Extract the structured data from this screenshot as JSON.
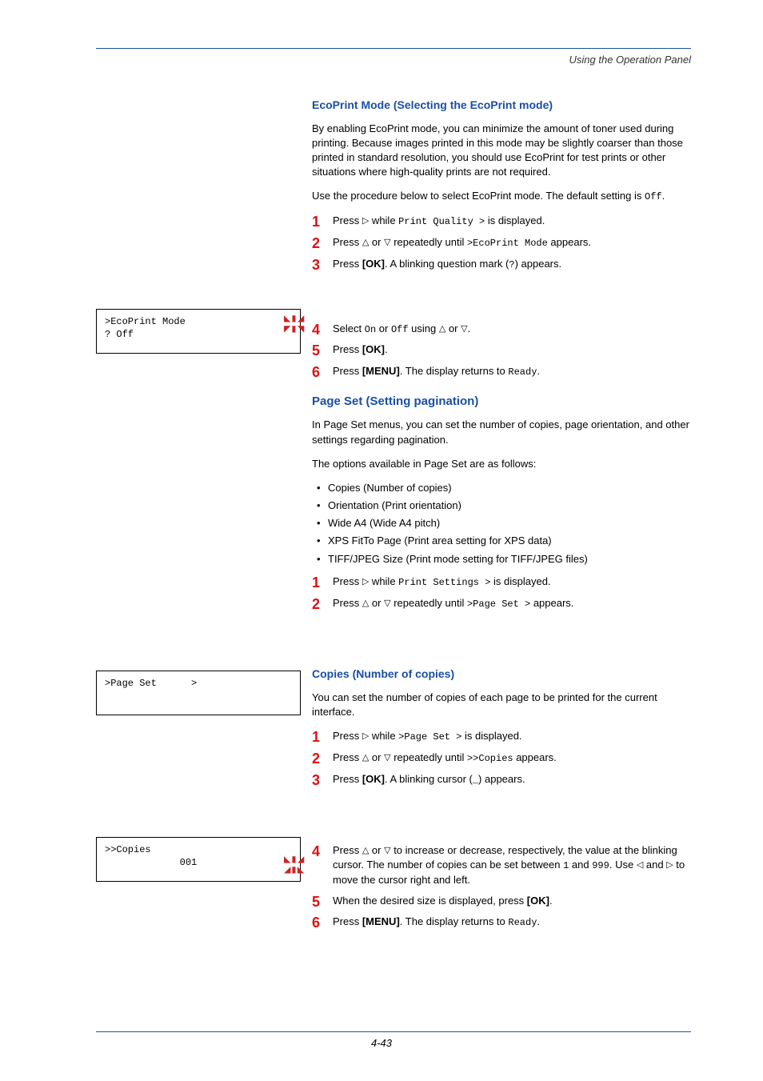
{
  "header": {
    "section": "Using the Operation Panel"
  },
  "ecoprint": {
    "title": "EcoPrint Mode (Selecting the EcoPrint mode)",
    "p1": "By enabling EcoPrint mode, you can minimize the amount of toner used during printing. Because images printed in this mode may be slightly coarser than those printed in standard resolution, you should use EcoPrint for test prints or other situations where high-quality prints are not required.",
    "p2": "Use the procedure below to select EcoPrint mode. The default setting is Off.",
    "steps": {
      "s1a": "Press ",
      "s1b": " while ",
      "s1c": "Print Quality >",
      "s1d": " is displayed.",
      "s2a": "Press ",
      "s2b": " or ",
      "s2c": " repeatedly until ",
      "s2d": ">EcoPrint Mode",
      "s2e": " appears.",
      "s3a": "Press ",
      "s3b": "[OK]",
      "s3c": ". A blinking question mark (",
      "s3d": "?",
      "s3e": ") appears.",
      "s4a": "Select ",
      "s4b": "On",
      "s4c": " or ",
      "s4d": "Off",
      "s4e": " using ",
      "s4f": " or ",
      "s4g": ".",
      "s5a": "Press ",
      "s5b": "[OK]",
      "s5c": ".",
      "s6a": "Press ",
      "s6b": "[MENU]",
      "s6c": ". The display returns to ",
      "s6d": "Ready",
      "s6e": "."
    },
    "box": {
      "line1": ">EcoPrint Mode",
      "line2": "? Off"
    }
  },
  "pageset": {
    "title": "Page Set (Setting pagination)",
    "p1": "In Page Set menus, you can set the number of copies, page orientation, and other settings regarding pagination.",
    "p2": "The options available in Page Set are as follows:",
    "bullets": {
      "b1": "Copies (Number of copies)",
      "b2": "Orientation (Print orientation)",
      "b3": "Wide A4 (Wide A4 pitch)",
      "b4": "XPS FitTo Page (Print area setting for XPS data)",
      "b5": "TIFF/JPEG Size (Print mode setting for TIFF/JPEG files)"
    },
    "steps": {
      "s1a": "Press ",
      "s1b": " while ",
      "s1c": "Print Settings >",
      "s1d": " is displayed.",
      "s2a": "Press ",
      "s2b": " or ",
      "s2c": " repeatedly until ",
      "s2d": ">Page Set >",
      "s2e": " appears."
    },
    "box": {
      "line1": ">Page Set      >"
    }
  },
  "copies": {
    "title": "Copies (Number of copies)",
    "p1": "You can set the number of copies of each page to be printed for the current interface.",
    "steps": {
      "s1a": "Press ",
      "s1b": " while ",
      "s1c": ">Page Set >",
      "s1d": " is displayed.",
      "s2a": "Press ",
      "s2b": " or ",
      "s2c": " repeatedly until ",
      "s2d": ">>Copies",
      "s2e": " appears.",
      "s3a": "Press ",
      "s3b": "[OK]",
      "s3c": ". A blinking cursor (",
      "s3d": "_",
      "s3e": ") appears.",
      "s4a": "Press ",
      "s4b": " or ",
      "s4c": " to increase or decrease, respectively, the value at the blinking cursor. The number of copies can be set between ",
      "s4d": "1",
      "s4e": " and ",
      "s4f": "999",
      "s4g": ". Use ",
      "s4h": " and ",
      "s4i": " to move the cursor right and left.",
      "s5a": "When the desired size is displayed, press ",
      "s5b": "[OK]",
      "s5c": ".",
      "s6a": "Press ",
      "s6b": "[MENU]",
      "s6c": ". The display returns to ",
      "s6d": "Ready",
      "s6e": "."
    },
    "box": {
      "line1": ">>Copies",
      "line2": "             001"
    }
  },
  "footer": {
    "page": "4-43"
  },
  "tri": {
    "right": "▷",
    "left": "◁",
    "up": "△",
    "down": "▽"
  }
}
